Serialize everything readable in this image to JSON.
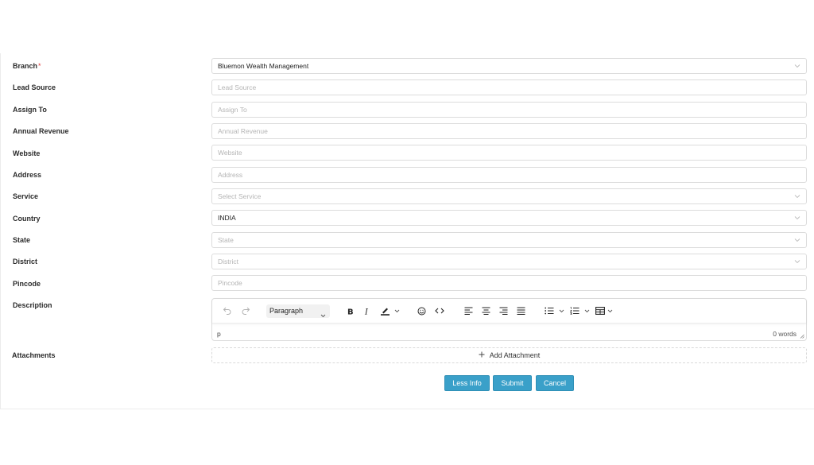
{
  "form": {
    "fields": [
      {
        "label": "Branch",
        "required": "*",
        "value": "Bluemon Wealth Management",
        "placeholder": "",
        "type": "select"
      },
      {
        "label": "Lead Source",
        "value": "",
        "placeholder": "Lead Source",
        "type": "input"
      },
      {
        "label": "Assign To",
        "value": "",
        "placeholder": "Assign To",
        "type": "input"
      },
      {
        "label": "Annual Revenue",
        "value": "",
        "placeholder": "Annual Revenue",
        "type": "input"
      },
      {
        "label": "Website",
        "value": "",
        "placeholder": "Website",
        "type": "input"
      },
      {
        "label": "Address",
        "value": "",
        "placeholder": "Address",
        "type": "input"
      },
      {
        "label": "Service",
        "value": "",
        "placeholder": "Select Service",
        "type": "select"
      },
      {
        "label": "Country",
        "value": "INDIA",
        "placeholder": "",
        "type": "select"
      },
      {
        "label": "State",
        "value": "",
        "placeholder": "State",
        "type": "select"
      },
      {
        "label": "District",
        "value": "",
        "placeholder": "District",
        "type": "select"
      },
      {
        "label": "Pincode",
        "value": "",
        "placeholder": "Pincode",
        "type": "input"
      }
    ],
    "description": {
      "label": "Description",
      "block_format": "Paragraph",
      "status_path": "p",
      "word_count": "0 words",
      "toolbar_icons": [
        "undo-icon",
        "redo-icon",
        "bold-icon",
        "italic-icon",
        "highlight-icon",
        "emoji-icon",
        "code-icon",
        "align-left-icon",
        "align-center-icon",
        "align-right-icon",
        "justify-icon",
        "bullet-list-icon",
        "numbered-list-icon",
        "table-icon"
      ]
    },
    "attachments": {
      "label": "Attachments",
      "button_label": "Add Attachment"
    },
    "actions": {
      "less_info": "Less Info",
      "submit": "Submit",
      "cancel": "Cancel"
    }
  },
  "colors": {
    "primary_button": "#3aa0c9",
    "required_marker": "#e03b3b",
    "field_border": "#dcdcdc"
  }
}
